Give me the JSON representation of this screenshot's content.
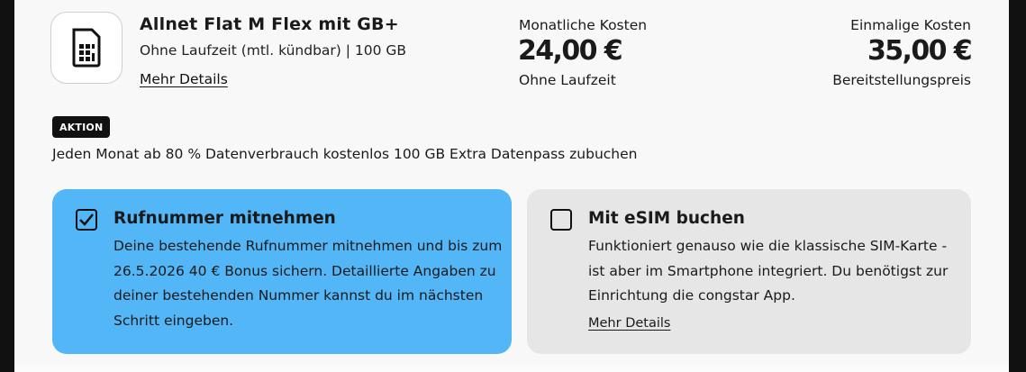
{
  "tariff": {
    "name": "Allnet Flat M Flex mit GB+",
    "subtitle": "Ohne Laufzeit (mtl. kündbar) | 100 GB",
    "details_link": "Mehr Details",
    "icon": "sim-card-icon"
  },
  "monthly": {
    "label": "Monatliche Kosten",
    "price": "24,00 €",
    "note": "Ohne Laufzeit"
  },
  "one_time": {
    "label": "Einmalige Kosten",
    "price": "35,00 €",
    "note": "Bereitstellungspreis"
  },
  "promo": {
    "badge": "AKTION",
    "text": "Jeden Monat ab 80 % Datenverbrauch kostenlos 100 GB Extra Datenpass zubuchen"
  },
  "options": [
    {
      "title": "Rufnummer mitnehmen",
      "checked": true,
      "lines": [
        "Deine bestehende Rufnummer mitnehmen und bis zum",
        "26.5.2026 40 € Bonus sichern. Detaillierte Angaben zu",
        "deiner bestehenden Nummer kannst du im nächsten",
        "Schritt eingeben."
      ],
      "color": "#52b6f7"
    },
    {
      "title": "Mit eSIM buchen",
      "checked": false,
      "lines": [
        "Funktioniert genauso wie die klassische SIM-Karte -",
        "ist aber im Smartphone integriert. Du benötigst zur",
        "Einrichtung die congstar App."
      ],
      "link": "Mehr Details",
      "color": "#e6e6e6"
    }
  ]
}
